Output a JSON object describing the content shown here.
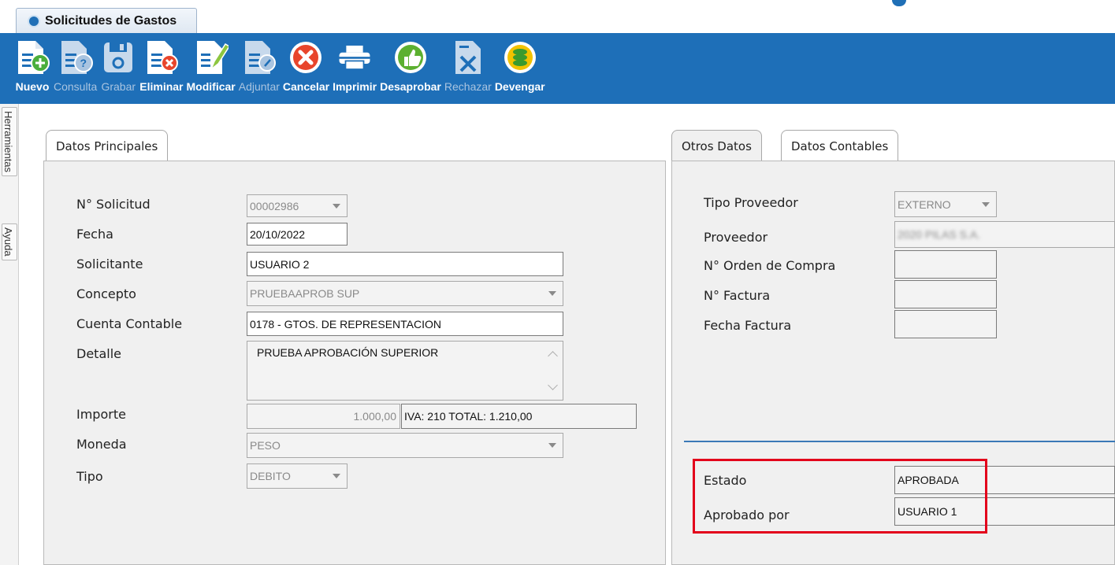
{
  "window": {
    "tab_title": "Solicitudes de Gastos"
  },
  "toolbar": {
    "buttons": [
      {
        "label": "Nuevo",
        "icon": "doc-add-icon",
        "enabled": true
      },
      {
        "label": "Consulta",
        "icon": "doc-query-icon",
        "enabled": false
      },
      {
        "label": "Grabar",
        "icon": "save-icon",
        "enabled": false
      },
      {
        "label": "Eliminar",
        "icon": "doc-delete-icon",
        "enabled": true
      },
      {
        "label": "Modificar",
        "icon": "doc-edit-icon",
        "enabled": true
      },
      {
        "label": "Adjuntar",
        "icon": "doc-attach-icon",
        "enabled": false
      },
      {
        "label": "Cancelar",
        "icon": "cancel-icon",
        "enabled": true
      },
      {
        "label": "Imprimir",
        "icon": "printer-icon",
        "enabled": true
      },
      {
        "label": "Desaprobar",
        "icon": "thumbs-icon",
        "enabled": true
      },
      {
        "label": "Rechazar",
        "icon": "doc-reject-icon",
        "enabled": false
      },
      {
        "label": "Devengar",
        "icon": "coins-icon",
        "enabled": true
      }
    ]
  },
  "side_tabs": {
    "herramientas": "Herramientas",
    "ayuda": "Ayuda"
  },
  "datos_principales": {
    "tab_label": "Datos Principales",
    "solicitud": {
      "label": "N° Solicitud",
      "value": "00002986"
    },
    "fecha": {
      "label": "Fecha",
      "value": "20/10/2022"
    },
    "solicitante": {
      "label": "Solicitante",
      "value": "USUARIO 2"
    },
    "concepto": {
      "label": "Concepto",
      "value": "PRUEBAAPROB SUP"
    },
    "cuenta": {
      "label": "Cuenta Contable",
      "value": "0178 - GTOS. DE REPRESENTACION"
    },
    "detalle": {
      "label": "Detalle",
      "value": "PRUEBA APROBACIÓN SUPERIOR"
    },
    "importe": {
      "label": "Importe",
      "value": "1.000,00",
      "iva_total": "IVA: 210 TOTAL:  1.210,00"
    },
    "moneda": {
      "label": "Moneda",
      "value": "PESO"
    },
    "tipo": {
      "label": "Tipo",
      "value": "DEBITO"
    }
  },
  "otros_datos": {
    "tab_label": "Otros Datos",
    "tab2_label": "Datos Contables",
    "tipo_proveedor": {
      "label": "Tipo Proveedor",
      "value": "EXTERNO"
    },
    "proveedor": {
      "label": "Proveedor",
      "value": "2020 PILAS S.A."
    },
    "orden_compra": {
      "label": "N° Orden de Compra",
      "value": ""
    },
    "factura": {
      "label": "N° Factura",
      "value": ""
    },
    "fecha_factura": {
      "label": "Fecha Factura",
      "value": ""
    },
    "estado": {
      "label": "Estado",
      "value": "APROBADA"
    },
    "aprobado_por": {
      "label": "Aprobado por",
      "value": "USUARIO 1"
    }
  },
  "colors": {
    "toolbar": "#1e6fb8",
    "highlight": "#e3001b"
  }
}
